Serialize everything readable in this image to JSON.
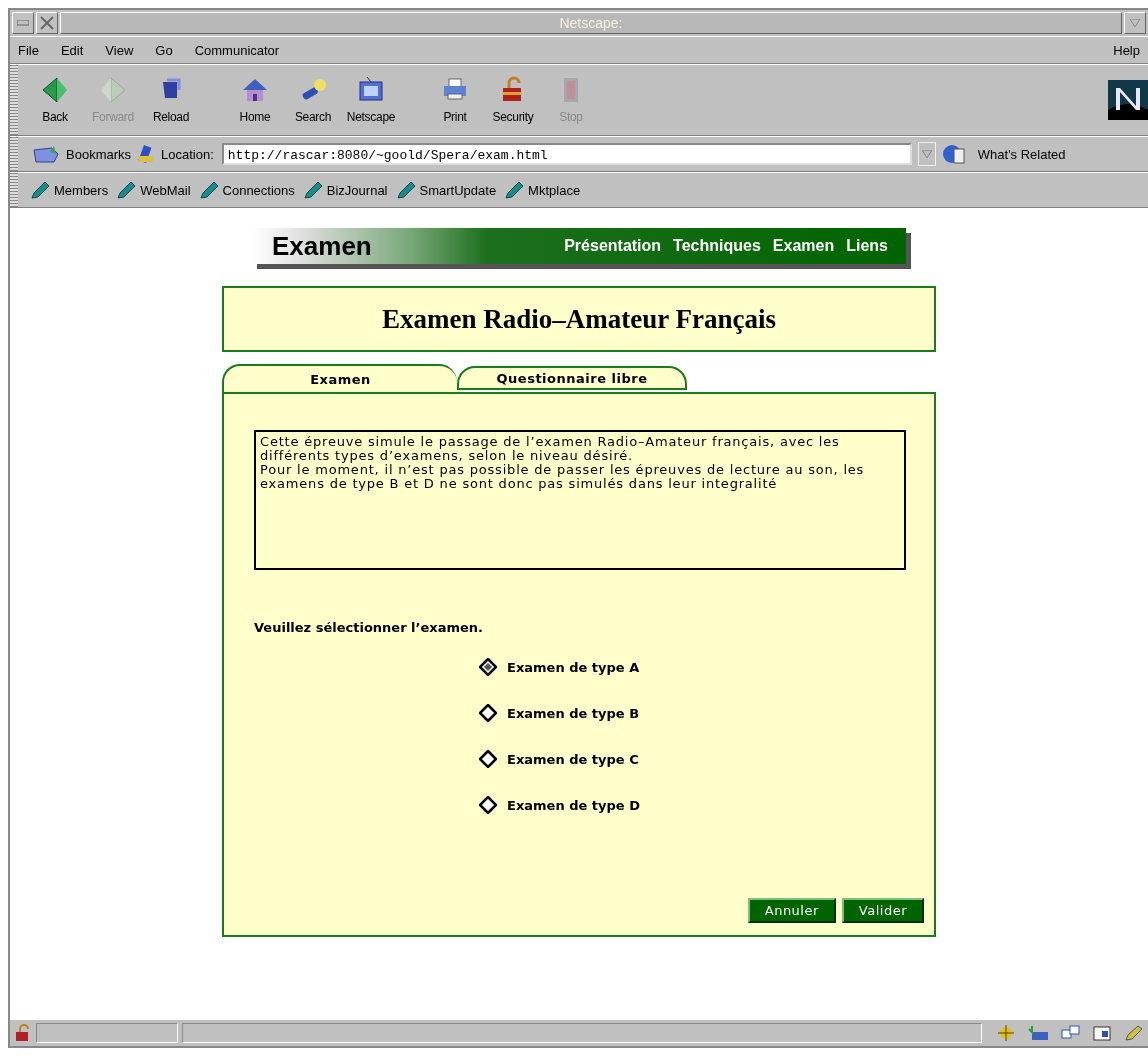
{
  "window": {
    "title": "Netscape:"
  },
  "menu": [
    {
      "label": "File"
    },
    {
      "label": "Edit"
    },
    {
      "label": "View"
    },
    {
      "label": "Go"
    },
    {
      "label": "Communicator"
    },
    {
      "label": "Help"
    }
  ],
  "toolbar": [
    {
      "label": "Back",
      "kind": "back",
      "disabled": false
    },
    {
      "label": "Forward",
      "kind": "forward",
      "disabled": true
    },
    {
      "label": "Reload",
      "kind": "reload",
      "disabled": false
    },
    {
      "label": "Home",
      "kind": "home",
      "disabled": false
    },
    {
      "label": "Search",
      "kind": "search",
      "disabled": false
    },
    {
      "label": "Netscape",
      "kind": "netscape",
      "disabled": false
    },
    {
      "label": "Print",
      "kind": "print",
      "disabled": false
    },
    {
      "label": "Security",
      "kind": "security",
      "disabled": false
    },
    {
      "label": "Stop",
      "kind": "stop",
      "disabled": true
    }
  ],
  "location_bar": {
    "bookmarks": "Bookmarks",
    "label": "Location:",
    "url": "http://rascar:8080/~goold/Spera/exam.html",
    "related": "What's Related"
  },
  "personal_bar": [
    {
      "label": "Members"
    },
    {
      "label": "WebMail"
    },
    {
      "label": "Connections"
    },
    {
      "label": "BizJournal"
    },
    {
      "label": "SmartUpdate"
    },
    {
      "label": "Mktplace"
    }
  ],
  "page": {
    "banner": {
      "title": "Examen",
      "links": [
        {
          "label": "Présentation"
        },
        {
          "label": "Techniques"
        },
        {
          "label": "Examen"
        },
        {
          "label": "Liens"
        }
      ]
    },
    "heading": "Examen Radio–Amateur Français",
    "tabs": [
      {
        "label": "Examen",
        "selected": true
      },
      {
        "label": "Questionnaire libre",
        "selected": false
      }
    ],
    "description": "Cette épreuve simule le passage de l’examen Radio–Amateur français, avec les différents types d’examens, selon le niveau désiré.\nPour le moment, il n’est pas possible de passer les épreuves de lecture au son, les examens de type B et D ne sont donc pas simulés dans leur integralité",
    "prompt": "Veuillez sélectionner l’examen.",
    "options": [
      {
        "label": "Examen de type A",
        "selected": true
      },
      {
        "label": "Examen de type B",
        "selected": false
      },
      {
        "label": "Examen de type C",
        "selected": false
      },
      {
        "label": "Examen de type D",
        "selected": false
      }
    ],
    "buttons": [
      {
        "label": "Annuler"
      },
      {
        "label": "Valider"
      }
    ]
  }
}
